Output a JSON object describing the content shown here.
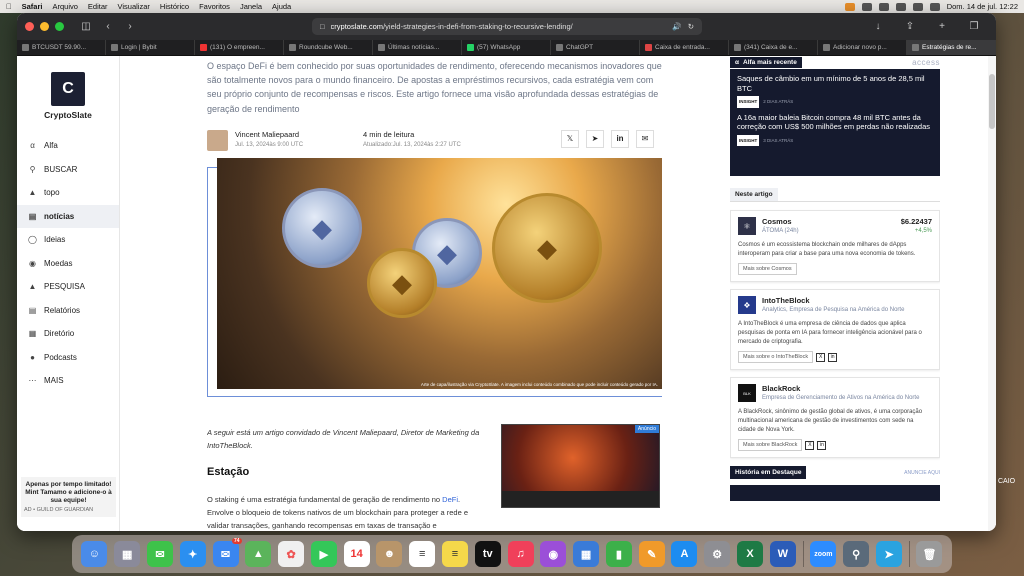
{
  "menubar": {
    "app": "Safari",
    "items": [
      "Arquivo",
      "Editar",
      "Visualizar",
      "Histórico",
      "Favoritos",
      "Janela",
      "Ajuda"
    ],
    "clock": "Dom. 14 de jul.  12:22"
  },
  "browser": {
    "url_domain": "cryptoslate.com",
    "url_path": "/yield-strategies-in-defi-from-staking-to-recursive-lending/",
    "tabs": [
      {
        "label": "BTCUSDT 59.90...",
        "active": false
      },
      {
        "label": "Login | Bybit",
        "active": false
      },
      {
        "label": "(131) O empreen...",
        "active": false
      },
      {
        "label": "Roundcube Web...",
        "active": false
      },
      {
        "label": "Últimas notícias...",
        "active": false
      },
      {
        "label": "(57) WhatsApp",
        "active": false
      },
      {
        "label": "ChatGPT",
        "active": false
      },
      {
        "label": "Caixa de entrada...",
        "active": false
      },
      {
        "label": "(341) Caixa de e...",
        "active": false
      },
      {
        "label": "Adicionar novo p...",
        "active": false
      },
      {
        "label": "Estratégias de re...",
        "active": true
      }
    ]
  },
  "sidebar": {
    "brand": "CryptoSlate",
    "items": [
      {
        "label": "Alfa",
        "icon": "alpha-icon"
      },
      {
        "label": "BUSCAR",
        "icon": "search-icon"
      },
      {
        "label": "topo",
        "icon": "flame-icon"
      },
      {
        "label": "notícias",
        "icon": "news-icon",
        "active": true
      },
      {
        "label": "Ideias",
        "icon": "lightbulb-icon"
      },
      {
        "label": "Moedas",
        "icon": "coins-icon"
      },
      {
        "label": "PESQUISA",
        "icon": "research-icon"
      },
      {
        "label": "Relatórios",
        "icon": "reports-icon"
      },
      {
        "label": "Diretório",
        "icon": "directory-icon"
      },
      {
        "label": "Podcasts",
        "icon": "microphone-icon"
      },
      {
        "label": "MAIS",
        "icon": "more-icon"
      }
    ],
    "promo_text": "Apenas por tempo limitado! Mint Tamamo e adicione-o à sua equipe!",
    "promo_ad": "AD • GUILD OF GUARDIAN"
  },
  "article": {
    "intro": "O espaço DeFi é bem conhecido por suas oportunidades de rendimento, oferecendo mecanismos inovadores que são totalmente novos para o mundo financeiro. De apostas a empréstimos recursivos, cada estratégia vem com seu próprio conjunto de recompensas e riscos. Este artigo fornece uma visão aprofundada dessas estratégias de geração de rendimento",
    "author": "Vincent Maliepaard",
    "date": "Jul. 13, 2024às 9:00 UTC",
    "read_time": "4 min de leitura",
    "updated": "Atualizado:Jul. 13, 2024às 2:27 UTC",
    "image_caption": "Arte de capa/ilustração via CryptoSlate. A imagem inclui conteúdo combinado que pode incluir conteúdo gerado por IA.",
    "lead": "A seguir está um artigo convidado de Vincent Maliepaard, Diretor de Marketing da IntoTheBlock.",
    "heading": "Estação",
    "body_before_link": "O staking é uma estratégia fundamental de geração de rendimento no ",
    "body_link": "DeFi",
    "body_after_link": ". Envolve o bloqueio de tokens nativos de um blockchain para proteger a rede e validar transações, ganhando recompensas em taxas de transação e",
    "ad_badge": "Anúncio"
  },
  "right": {
    "alfa_label": "Alfa mais recente",
    "access_label": "access",
    "news": [
      {
        "title": "Saques de câmbio em um mínimo de 5 anos de 28,5 mil BTC",
        "tag": "INSIGHT",
        "time": "2 DIAS ATRÁS"
      },
      {
        "title": "A 16a maior baleia Bitcoin compra 48 mil BTC antes da correção com US$ 500 milhões em perdas não realizadas",
        "tag": "INSIGHT",
        "time": "3 DIAS ATRÁS"
      }
    ],
    "in_article_label": "Neste artigo",
    "cards": [
      {
        "name": "Cosmos",
        "sub": "ÁTOMA (24h)",
        "price": "$6.22437",
        "change": "+4,5%",
        "desc": "Cosmos é um ecossistema blockchain onde milhares de dApps interoperam para criar a base para uma nova economia de tokens.",
        "more": "Mais sobre Cosmos"
      },
      {
        "name": "IntoTheBlock",
        "sub": "Analytics, Empresa de Pesquisa na América do Norte",
        "desc": "A IntoTheBlock é uma empresa de ciência de dados que aplica pesquisas de ponta em IA para fornecer inteligência acionável para o mercado de criptografia.",
        "more": "Mais sobre o IntoTheBlock"
      },
      {
        "name": "BlackRock",
        "sub": "Empresa de Gerenciamento de Ativos na América do Norte",
        "desc": "A BlackRock, sinônimo de gestão global de ativos, é uma corporação multinacional americana de gestão de investimentos com sede na cidade de Nova York.",
        "more": "Mais sobre BlackRock"
      }
    ],
    "featured_label": "História em Destaque",
    "featured_ad": "ANUNCIE AQUI"
  },
  "desktop_label": "CAIO",
  "dock": {
    "calendar_day": "14",
    "mail_badge": "74"
  }
}
